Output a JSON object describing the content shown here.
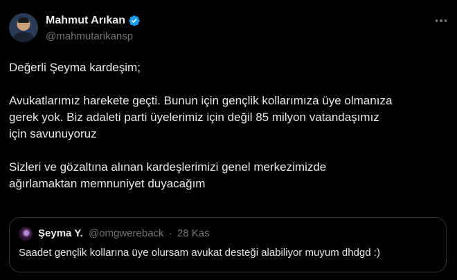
{
  "author": {
    "display_name": "Mahmut Arıkan",
    "handle": "@mahmutarikansp",
    "verified": true,
    "verified_badge_color": "#1d9bf0"
  },
  "tweet": {
    "paragraph1": "Değerli Şeyma kardeşim;",
    "paragraph2_line1": "Avukatlarımız harekete geçti. Bunun için gençlik kollarımıza üye olmanıza",
    "paragraph2_line2": "gerek yok. Biz adaleti parti üyelerimiz için değil 85 milyon vatandaşımız",
    "paragraph2_line3": "için savunuyoruz",
    "paragraph3_line1": "Sizleri ve gözaltına alınan kardeşlerimizi genel merkezimizde",
    "paragraph3_line2": "ağırlamaktan memnuniyet duyacağım"
  },
  "quoted_tweet": {
    "display_name": "Şeyma Y.",
    "handle": "@omgwereback",
    "separator": "·",
    "date": "28 Kas",
    "text": "Saadet gençlik kollarına üye olursam avukat desteği alabiliyor muyum dhdgd :)"
  },
  "icons": {
    "more": "more-horizontal-icon",
    "verified": "verified-badge-icon"
  },
  "colors": {
    "background": "#000000",
    "text_primary": "#e7e9ea",
    "text_secondary": "#71767b",
    "border": "#2f3336"
  }
}
